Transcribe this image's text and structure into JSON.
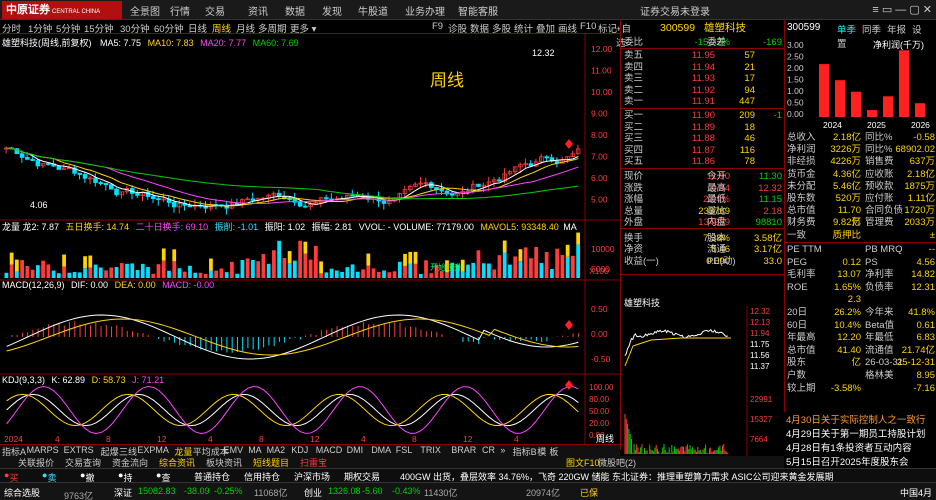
{
  "app": {
    "brand": "中原证券",
    "brand_en": "CENTRAL CHINA SECURITIES",
    "menu": [
      "全景图",
      "行情",
      "交易",
      "资讯",
      "数据",
      "发现",
      "牛股道",
      "业务办理",
      "智能客服"
    ],
    "login_status": "证券交易未登录",
    "win_controls": "≡ ▭ — ▢ ✕"
  },
  "periods": [
    "分时",
    "1分钟",
    "5分钟",
    "15分钟",
    "30分钟",
    "60分钟",
    "日线",
    "周线",
    "月线",
    "多周期",
    "更多 ▾"
  ],
  "period_active": "周线",
  "view_tabs": [
    "F9",
    "诊股",
    "数据",
    "多股",
    "统计",
    "叠加",
    "画线",
    "F10",
    "标记",
    "+自选",
    "»"
  ],
  "chart": {
    "title": "雄塑科技(周线,前复权)",
    "ma": {
      "ma5": "MA5: 7.75",
      "ma10": "MA10: 7.83",
      "ma20": "MA20: 7.77",
      "ma60": "MA60: 7.69"
    },
    "watermark": "周线",
    "high_label": "12.32",
    "low_label": "4.06",
    "price_axis": [
      "12.00",
      "11.00",
      "10.00",
      "9.00",
      "8.00",
      "7.00",
      "6.00",
      "5.00"
    ],
    "vol_legend": {
      "a": "龙量 龙2: 7.87",
      "b": "五日换手: 14.74",
      "c": "二十日换手: 69.10",
      "d": "振削: -1.01",
      "e": "振阳: 1.02",
      "f": "振幅: 2.81",
      "g": "VVOL: - VOLUME: 77179.00",
      "h": "MAVOL5: 93348.40",
      "i": "MA"
    },
    "vol_axis": [
      "10000",
      "5000"
    ],
    "vol_unit": "X100",
    "vol_tag": "开始拉升",
    "macd_legend": {
      "name": "MACD(12,26,9)",
      "dif": "DIF: 0.00",
      "dea": "DEA: 0.00",
      "macd": "MACD: -0.00"
    },
    "macd_axis": [
      "0.50",
      "0.00",
      "-0.50"
    ],
    "kdj_legend": {
      "name": "KDJ(9,3,3)",
      "k": "K: 62.89",
      "d": "D: 58.73",
      "j": "J: 71.21"
    },
    "kdj_axis": [
      "100.00",
      "80.00",
      "50.00",
      "20.00",
      "0.00"
    ],
    "time_axis": [
      "2024",
      "4",
      "8",
      "12",
      "4",
      "8",
      "12",
      "4",
      "8",
      "12",
      "4"
    ]
  },
  "indicators": [
    "指标A",
    "MARPS",
    "EXTRS",
    "起爆",
    "三线",
    "EXPMA",
    "龙量",
    "平均成本",
    "EMV",
    "MA",
    "MA2",
    "KDJ",
    "MACD",
    "DMI",
    "DMA",
    "FSL",
    "TRIX",
    "BRAR",
    "CR",
    "»",
    "指标B",
    "模",
    "板"
  ],
  "indicator_active": "龙量",
  "sub_tabs": [
    "关联报价",
    "交易查询",
    "资金流向",
    "综合资讯",
    "板块资讯",
    "短线题目",
    "扫雷宝"
  ],
  "sub_tab_extra": "图文F10",
  "sub_tab_extra2": "微股吧(2)",
  "quote": {
    "code": "300599",
    "name": "雄塑科技",
    "weibi_label": "委比",
    "weibi": "-15.32%",
    "weicha_label": "委差",
    "weicha": "-169",
    "asks": [
      {
        "label": "卖五",
        "price": "11.95",
        "vol": "57"
      },
      {
        "label": "卖四",
        "price": "11.94",
        "vol": "21"
      },
      {
        "label": "卖三",
        "price": "11.93",
        "vol": "17"
      },
      {
        "label": "卖二",
        "price": "11.92",
        "vol": "94"
      },
      {
        "label": "卖一",
        "price": "11.91",
        "vol": "447"
      }
    ],
    "bids": [
      {
        "label": "买一",
        "price": "11.90",
        "vol": "209",
        "chg": "-1"
      },
      {
        "label": "买二",
        "price": "11.89",
        "vol": "18",
        "chg": ""
      },
      {
        "label": "买三",
        "price": "11.88",
        "vol": "46",
        "chg": ""
      },
      {
        "label": "买四",
        "price": "11.87",
        "vol": "116",
        "chg": ""
      },
      {
        "label": "买五",
        "price": "11.86",
        "vol": "78",
        "chg": ""
      }
    ],
    "stats": [
      {
        "l": "现价",
        "v": "11.90",
        "l2": "今开",
        "v2": "11.30",
        "c": "red",
        "c2": "grn"
      },
      {
        "l": "涨跌",
        "v": "0.34",
        "l2": "最高",
        "v2": "12.32",
        "c": "red",
        "c2": "red"
      },
      {
        "l": "涨幅",
        "v": "2.94%",
        "l2": "最低",
        "v2": "11.15",
        "c": "red",
        "c2": "grn"
      },
      {
        "l": "总量",
        "v": "233769",
        "l2": "量比",
        "v2": "2.18",
        "c": "yel",
        "c2": "red"
      },
      {
        "l": "外盘",
        "v": "134959",
        "l2": "内盘",
        "v2": "98810",
        "c": "red",
        "c2": "grn"
      },
      {
        "l": "换手",
        "v": "7.38%",
        "l2": "股本",
        "v2": "3.58亿",
        "c": "yel",
        "c2": "yel"
      },
      {
        "l": "净资",
        "v": "5.46",
        "l2": "流通",
        "v2": "3.17亿",
        "c": "yel",
        "c2": "yel"
      },
      {
        "l": "收益(一)",
        "v": "0.090",
        "l2": "PE(动)",
        "v2": "33.0",
        "c": "yel",
        "c2": "yel"
      }
    ],
    "mini_title": "雄塑科技",
    "mini_axis": [
      "12.32",
      "12.13",
      "11.94",
      "11.75",
      "11.56",
      "11.37"
    ],
    "mini_vol_axis": [
      "22991",
      "15327",
      "7664"
    ],
    "mini_tabs": [
      "笔",
      "价",
      "细",
      "势",
      "联",
      "值",
      "主",
      "筹"
    ]
  },
  "fin": {
    "code": "300599",
    "tabs": [
      "单季",
      "同季",
      "年报",
      "设置"
    ],
    "chart_title": "净利润(千万)",
    "chart_axis": [
      "3.00",
      "2.50",
      "2.00",
      "1.50",
      "1.00",
      "0.50",
      "0.00"
    ],
    "chart_bars": [
      {
        "year": "2024",
        "value": 2.3
      },
      {
        "year": "2024b",
        "value": 1.6
      },
      {
        "year": "2024c",
        "value": 1.1
      },
      {
        "year": "2025",
        "value": 0.3
      },
      {
        "year": "2025b",
        "value": 0.9
      },
      {
        "year": "2025c",
        "value": 2.9
      },
      {
        "year": "2026",
        "value": 0.6
      }
    ],
    "chart_years": [
      "2024",
      "2025",
      "2026"
    ],
    "rows": [
      {
        "l": "总收入",
        "v": "2.18亿",
        "l2": "同比%",
        "v2": "-0.58"
      },
      {
        "l": "净利润",
        "v": "3226万",
        "l2": "同比%",
        "v2": "68902.02"
      },
      {
        "l": "非经损",
        "v": "4226万",
        "l2": "销售费",
        "v2": "637万"
      },
      {
        "l": "货币金",
        "v": "4.36亿",
        "l2": "应收账",
        "v2": "2.18亿"
      },
      {
        "l": "未分配",
        "v": "5.46亿",
        "l2": "预收款",
        "v2": "1875万"
      },
      {
        "l": "股东数",
        "v": "520万",
        "l2": "应付账",
        "v2": "1.11亿"
      },
      {
        "l": "总市值",
        "v": "11.70亿",
        "l2": "合同负债",
        "v2": "1720万"
      },
      {
        "l": "财务费",
        "v": "9.82万",
        "l2": "管理费",
        "v2": "2033万"
      },
      {
        "l": "一致",
        "v": "质押比",
        "l2": "",
        "v2": "±"
      }
    ],
    "rows2": [
      {
        "l": "PE TTM",
        "v": "",
        "l2": "PB MRQ",
        "v2": "--"
      },
      {
        "l": "PEG",
        "v": "0.12",
        "l2": "PS",
        "v2": "4.56"
      },
      {
        "l": "毛利率",
        "v": "13.07",
        "l2": "净利率",
        "v2": "14.82"
      },
      {
        "l": "ROE",
        "v": "1.65%",
        "l2": "负债率",
        "v2": "12.31"
      },
      {
        "l": "",
        "v": "2.3",
        "l2": "",
        "v2": ""
      },
      {
        "l": "20日",
        "v": "26.2%",
        "l2": "今年来",
        "v2": "41.8%"
      },
      {
        "l": "60日",
        "v": "10.4%",
        "l2": "Beta值",
        "v2": "0.61"
      },
      {
        "l": "年最高",
        "v": "12.20",
        "l2": "年最低",
        "v2": "6.83"
      },
      {
        "l": "总市值",
        "v": "41.40亿",
        "l2": "流通值",
        "v2": "21.74亿"
      },
      {
        "l": "股东",
        "v": "",
        "l2": "26-03-31",
        "v2": "25-12-31"
      },
      {
        "l": "户数",
        "v": "",
        "l2": "格林美",
        "v2": "8.95"
      },
      {
        "l": "较上期",
        "v": "-3.58%",
        "l2": "",
        "v2": "-7.16"
      }
    ],
    "peer_extra": "-7.1"
  },
  "news": [
    "4月30日关于实际控制人之一致行",
    "4月29日关于第一期员工持股计划",
    "4月28日有1条投资者互动内容",
    "5月15日召开2025年度股东会"
  ],
  "trade": {
    "buy": "买入",
    "sell": "卖出",
    "withdraw": "撤单",
    "hold": "持仓",
    "query": "查询",
    "tabs": [
      "普通持仓",
      "信用持仓",
      "沪深市场",
      "期权交易"
    ],
    "ticker": "400GW 出货，叠层效率 34.76%，飞奇 220GW 储能 东北证券：推理重塑算力需求 ASIC公司迎来黄金发展期"
  },
  "status": {
    "sh_label": "上证",
    "sh_val": "9763亿",
    "sz_label": "深证",
    "sz_idx": "15082.83",
    "sz_chg": "-38.09",
    "sz_pct": "-0.25%",
    "sz_amt": "11068亿",
    "cy_label": "创业",
    "cy_idx": "1326.08",
    "cy_chg": "-5.60",
    "cy_pct": "-0.43%",
    "cy_amt": "11430亿",
    "cy_idx2": "20974亿",
    "safety": "已保",
    "right": "中国4月",
    "mode": "综合选股"
  }
}
